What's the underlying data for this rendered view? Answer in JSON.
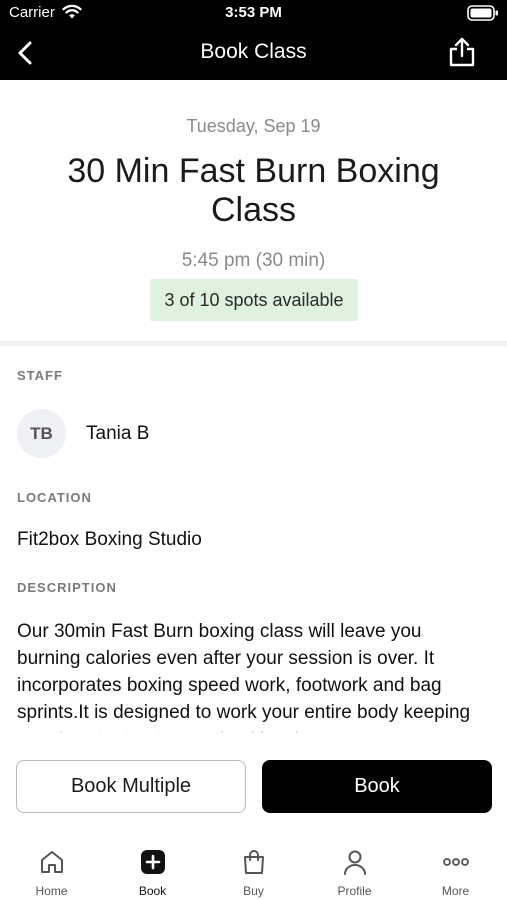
{
  "status_bar": {
    "carrier": "Carrier",
    "time": "3:53 PM"
  },
  "nav": {
    "title": "Book Class",
    "back_icon": "chevron-left-icon",
    "share_icon": "share-icon"
  },
  "class_info": {
    "date": "Tuesday, Sep 19",
    "title": "30 Min Fast Burn Boxing Class",
    "time_range": "5:45 pm (30 min)",
    "spots": "3 of 10 spots available",
    "spots_color": "#dff1df"
  },
  "staff": {
    "label": "STAFF",
    "initials": "TB",
    "name": "Tania B"
  },
  "location": {
    "label": "LOCATION",
    "value": "Fit2box Boxing Studio"
  },
  "description": {
    "label": "DESCRIPTION",
    "text": "Our 30min Fast Burn boxing class will leave you burning calories even after your session is over. It incorporates boxing speed work, footwork and bag sprints.It is designed to work your entire body keeping your heart rate at an optimal level"
  },
  "actions": {
    "book_multiple": "Book Multiple",
    "book": "Book"
  },
  "tabs": [
    {
      "label": "Home",
      "icon": "home-icon",
      "active": false
    },
    {
      "label": "Book",
      "icon": "add-square-icon",
      "active": true
    },
    {
      "label": "Buy",
      "icon": "shopping-bag-icon",
      "active": false
    },
    {
      "label": "Profile",
      "icon": "person-icon",
      "active": false
    },
    {
      "label": "More",
      "icon": "more-dots-icon",
      "active": false
    }
  ],
  "colors": {
    "header_bg": "#000000",
    "accent": "#000000",
    "muted_text": "#8a8a8a"
  }
}
